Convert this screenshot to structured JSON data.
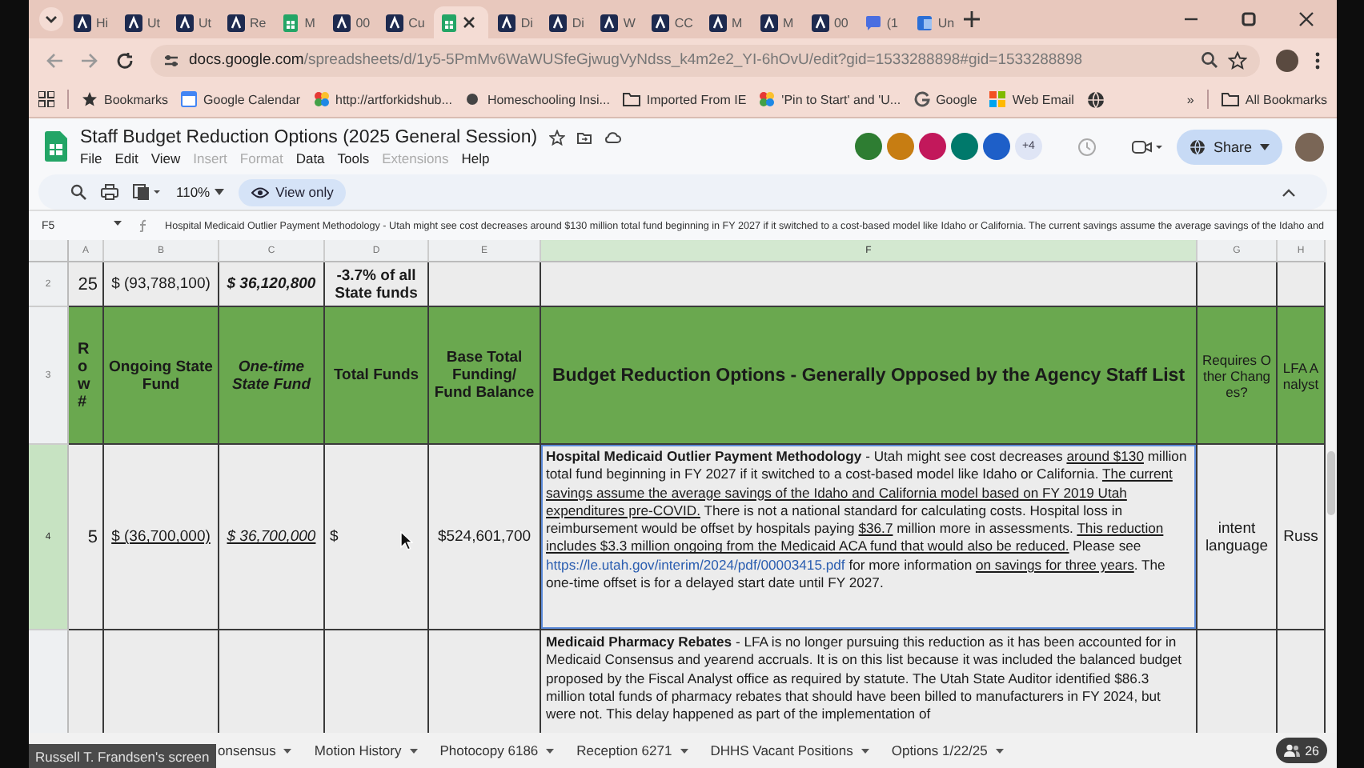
{
  "browser": {
    "tabs": [
      {
        "label": "Hi",
        "kind": "app",
        "selected": false
      },
      {
        "label": "Ut",
        "kind": "app",
        "selected": false
      },
      {
        "label": "Ut",
        "kind": "app",
        "selected": false
      },
      {
        "label": "Re",
        "kind": "app",
        "selected": false
      },
      {
        "label": "M",
        "kind": "sheets",
        "selected": false
      },
      {
        "label": "00",
        "kind": "app",
        "selected": false
      },
      {
        "label": "Cu",
        "kind": "app",
        "selected": false
      },
      {
        "kind": "sheets",
        "selected": true
      },
      {
        "label": "Di",
        "kind": "app",
        "selected": false
      },
      {
        "label": "Di",
        "kind": "app",
        "selected": false
      },
      {
        "label": "W",
        "kind": "app",
        "selected": false
      },
      {
        "label": "CC",
        "kind": "app",
        "selected": false
      },
      {
        "label": "M",
        "kind": "app",
        "selected": false
      },
      {
        "label": "M",
        "kind": "app",
        "selected": false
      },
      {
        "label": "00",
        "kind": "app",
        "selected": false
      },
      {
        "label": "(1",
        "kind": "chat",
        "selected": false
      },
      {
        "label": "Un",
        "kind": "word",
        "selected": false
      }
    ],
    "url_host": "docs.google.com",
    "url_path": "/spreadsheets/d/1y5-5PmMv6WaWUSfeGjwugVyNdss_k4m2e2_YI-6hOvU/edit?gid=1533288898#gid=1533288898",
    "bookmarks": [
      {
        "label": "Bookmarks",
        "kind": "star"
      },
      {
        "label": "Google Calendar",
        "kind": "calendar"
      },
      {
        "label": "http://artforkidshub...",
        "kind": "art"
      },
      {
        "label": "Homeschooling Insi...",
        "kind": "dot"
      },
      {
        "label": "Imported From IE",
        "kind": "folder"
      },
      {
        "label": "'Pin to Start' and 'U...",
        "kind": "art"
      },
      {
        "label": "Google",
        "kind": "g"
      },
      {
        "label": "Web Email",
        "kind": "windows"
      }
    ],
    "more_bookmarks": "»",
    "all_bookmarks": "All Bookmarks"
  },
  "doc": {
    "title": "Staff Budget Reduction Options (2025 General Session)",
    "menu": [
      {
        "label": "File",
        "disabled": false
      },
      {
        "label": "Edit",
        "disabled": false
      },
      {
        "label": "View",
        "disabled": false
      },
      {
        "label": "Insert",
        "disabled": true
      },
      {
        "label": "Format",
        "disabled": true
      },
      {
        "label": "Data",
        "disabled": false
      },
      {
        "label": "Tools",
        "disabled": false
      },
      {
        "label": "Extensions",
        "disabled": true
      },
      {
        "label": "Help",
        "disabled": false
      }
    ],
    "collaborators": [
      {
        "color": "#2e7d32"
      },
      {
        "color": "#c77d12"
      },
      {
        "color": "#c2185b"
      },
      {
        "color": "#00796b"
      },
      {
        "color": "#1e5fc8"
      }
    ],
    "more_collaborators": "+4",
    "share": "Share",
    "zoom": "110%",
    "mode": "View only",
    "name_box": "F5",
    "formula": "Hospital Medicaid Outlier Payment Methodology - Utah might see cost decreases around $130 million total fund beginning in FY 2027 if it switched to a cost-based model like Idaho or California. The current savings assume the average savings of the Idaho and"
  },
  "grid": {
    "columns": [
      {
        "label": "A",
        "selected": false
      },
      {
        "label": "B",
        "selected": false
      },
      {
        "label": "C",
        "selected": false
      },
      {
        "label": "D",
        "selected": false
      },
      {
        "label": "E",
        "selected": false
      },
      {
        "label": "F",
        "selected": true
      },
      {
        "label": "G",
        "selected": false
      },
      {
        "label": "H",
        "selected": false
      }
    ],
    "rows": [
      {
        "number": "2",
        "kind": "data",
        "selected": false,
        "cells": [
          {
            "text": "25",
            "kind": "plain"
          },
          {
            "text": "$ (93,788,100)",
            "kind": "plain"
          },
          {
            "text": "$ 36,120,800",
            "kind": "italic"
          },
          {
            "text": "-3.7% of all State funds",
            "kind": "plain"
          },
          null,
          null,
          null,
          null
        ]
      },
      {
        "number": "3",
        "kind": "header",
        "selected": false,
        "cells": [
          {
            "text": "Row#",
            "kind": "vertical"
          },
          {
            "text": "Ongoing State Fund",
            "kind": "plain"
          },
          {
            "text": "One-time State Fund",
            "kind": "italic"
          },
          {
            "text": "Total Funds",
            "kind": "plain"
          },
          {
            "text": "Base Total Funding/ Fund Balance",
            "kind": "plain"
          },
          {
            "text": "Budget Reduction Options - Generally Opposed by the Agency Staff List",
            "kind": "large"
          },
          {
            "text": "Requires Other Changes?",
            "kind": "narrow"
          },
          {
            "text": "LFA Analyst",
            "kind": "narrow"
          }
        ]
      },
      {
        "number": "4",
        "kind": "data",
        "selected": true,
        "cells": [
          {
            "text": "5",
            "kind": "plain"
          },
          {
            "text": "$ (36,700,000)",
            "kind": "underline"
          },
          {
            "text": "$ 36,700,000",
            "kind": "italic-underline"
          },
          {
            "text": "$",
            "kind": "plain"
          },
          {
            "text": "$524,601,700",
            "kind": "plain"
          },
          {
            "segments": [
              {
                "text": "Hospital Medicaid Outlier Payment Methodology",
                "kind": "bold"
              },
              {
                "text": " - Utah might see cost decreases ",
                "kind": "plain"
              },
              {
                "text": "around $130",
                "kind": "underline"
              },
              {
                "text": " million total fund beginning in FY 2027 if it switched to a cost-based model like Idaho or California. ",
                "kind": "plain"
              },
              {
                "text": "The current savings assume the average savings of the Idaho and California model based on FY 2019 Utah expenditures pre-COVID.",
                "kind": "underline"
              },
              {
                "text": " There is not a national standard for calculating costs. Hospital loss in reimbursement would be offset by hospitals paying ",
                "kind": "plain"
              },
              {
                "text": "$36.7",
                "kind": "underline"
              },
              {
                "text": " million more in assessments. ",
                "kind": "plain"
              },
              {
                "text": "This reduction includes $3.3 million ongoing from the Medicaid ACA fund that would also be reduced.",
                "kind": "underline"
              },
              {
                "text": " Please see ",
                "kind": "plain"
              },
              {
                "text": "https://le.utah.gov/interim/2024/pdf/00003415.pdf",
                "kind": "link"
              },
              {
                "text": " for more information ",
                "kind": "plain"
              },
              {
                "text": "on savings for three years",
                "kind": "underline"
              },
              {
                "text": ". The one-time offset is for a delayed start date until FY 2027.",
                "kind": "plain"
              }
            ]
          },
          {
            "text": "intent language",
            "kind": "plain"
          },
          {
            "text": "Russ",
            "kind": "plain"
          }
        ]
      },
      {
        "kind": "data",
        "selected": false,
        "cells": [
          null,
          null,
          null,
          null,
          null,
          {
            "segments": [
              {
                "text": "Medicaid Pharmacy Rebates",
                "kind": "bold"
              },
              {
                "text": " - LFA is no longer pursuing this reduction as it has been accounted for in Medicaid Consensus and yearend accruals. It is on this list because it was included the balanced budget proposed by the Fiscal Analyst office as required by statute. The Utah State Auditor identified $86.3 million total funds of pharmacy rebates that should have been billed to manufacturers in FY 2024, but were not. This delay happened as part of the implementation of",
                "kind": "plain"
              }
            ]
          },
          null,
          null
        ]
      }
    ]
  },
  "sheet_tabs": [
    {
      "label": "onsensus"
    },
    {
      "label": "Motion History"
    },
    {
      "label": "Photocopy 6186"
    },
    {
      "label": "Reception 6271"
    },
    {
      "label": "DHHS Vacant Positions"
    },
    {
      "label": "Options 1/22/25"
    }
  ],
  "presenter_label": "Russell T. Frandsen's screen",
  "participants": "26"
}
